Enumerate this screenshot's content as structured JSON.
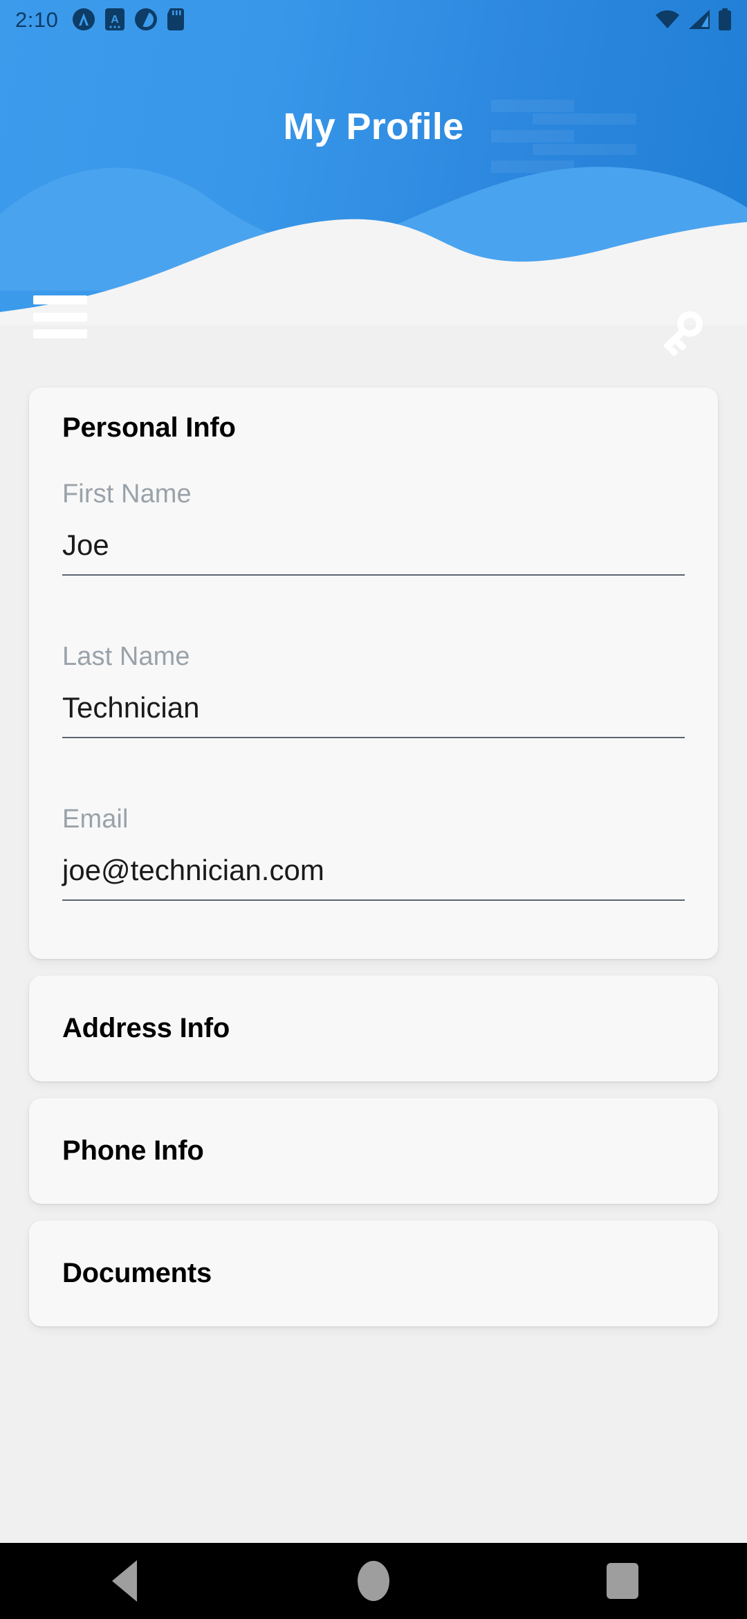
{
  "status_bar": {
    "time": "2:10",
    "left_icons": [
      "nova-launcher-icon",
      "screenshot-app-icon",
      "clock-app-icon",
      "sd-card-icon"
    ],
    "right_icons": [
      "wifi-icon",
      "cellular-signal-icon",
      "battery-icon"
    ],
    "icon_color": "#0d3c66"
  },
  "app_bar": {
    "title": "My Profile",
    "menu_icon": "hamburger-menu-icon",
    "action_icon": "key-icon",
    "gradient_from": "#3d9bec",
    "gradient_to": "#1f7fd4"
  },
  "sections": [
    {
      "title": "Personal Info",
      "expanded": true,
      "fields": [
        {
          "label": "First Name",
          "value": "Joe"
        },
        {
          "label": "Last Name",
          "value": "Technician"
        },
        {
          "label": "Email",
          "value": "joe@technician.com"
        }
      ]
    },
    {
      "title": "Address Info",
      "expanded": false,
      "fields": []
    },
    {
      "title": "Phone Info",
      "expanded": false,
      "fields": []
    },
    {
      "title": "Documents",
      "expanded": false,
      "fields": []
    }
  ],
  "nav_bar": {
    "back": "back-triangle-icon",
    "home": "home-circle-icon",
    "recents": "recents-square-icon",
    "icon_color": "#9e9e9e"
  }
}
